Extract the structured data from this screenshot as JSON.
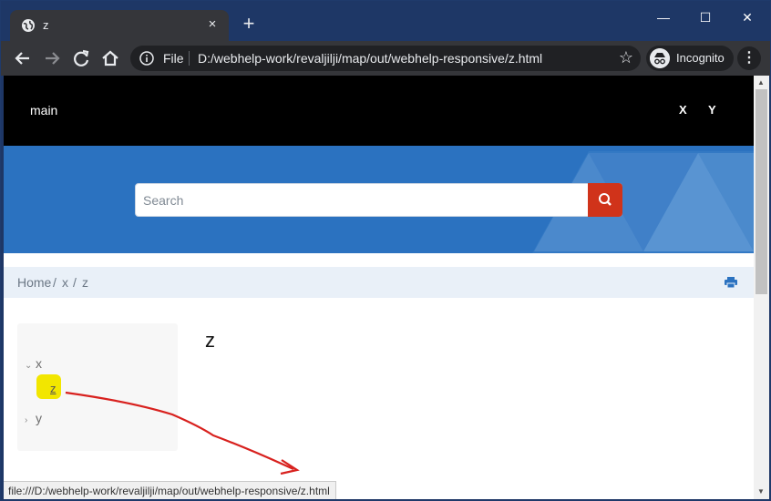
{
  "browser": {
    "tab_title": "z",
    "tab_close": "×",
    "new_tab": "+",
    "window_controls": {
      "minimize": "—",
      "maximize": "☐",
      "close": "✕"
    },
    "omnibox_scheme": "File",
    "url": "D:/webhelp-work/revaljilji/map/out/webhelp-responsive/z.html",
    "incognito_label": "Incognito",
    "status_url": "file:///D:/webhelp-work/revaljilji/map/out/webhelp-responsive/z.html"
  },
  "site": {
    "brand": "main",
    "nav": [
      "X",
      "Y"
    ],
    "search_placeholder": "Search"
  },
  "breadcrumb": [
    "Home",
    "/",
    "x",
    "/",
    "z"
  ],
  "toc": {
    "items": [
      {
        "label": "x",
        "expanded": true
      },
      {
        "label": "z",
        "active": true
      },
      {
        "label": "y",
        "expanded": false
      }
    ]
  },
  "page": {
    "title": "z"
  },
  "colors": {
    "accent_red": "#d0331a",
    "hero_blue": "#2b72c0",
    "highlight": "#f2e600",
    "annotation": "#d8211e"
  },
  "icons": [
    "globe-icon",
    "back-icon",
    "forward-icon",
    "reload-icon",
    "home-icon",
    "info-icon",
    "star-icon",
    "incognito-icon",
    "kebab-menu-icon",
    "search-icon",
    "print-icon",
    "chevron-down-icon",
    "chevron-right-icon"
  ]
}
